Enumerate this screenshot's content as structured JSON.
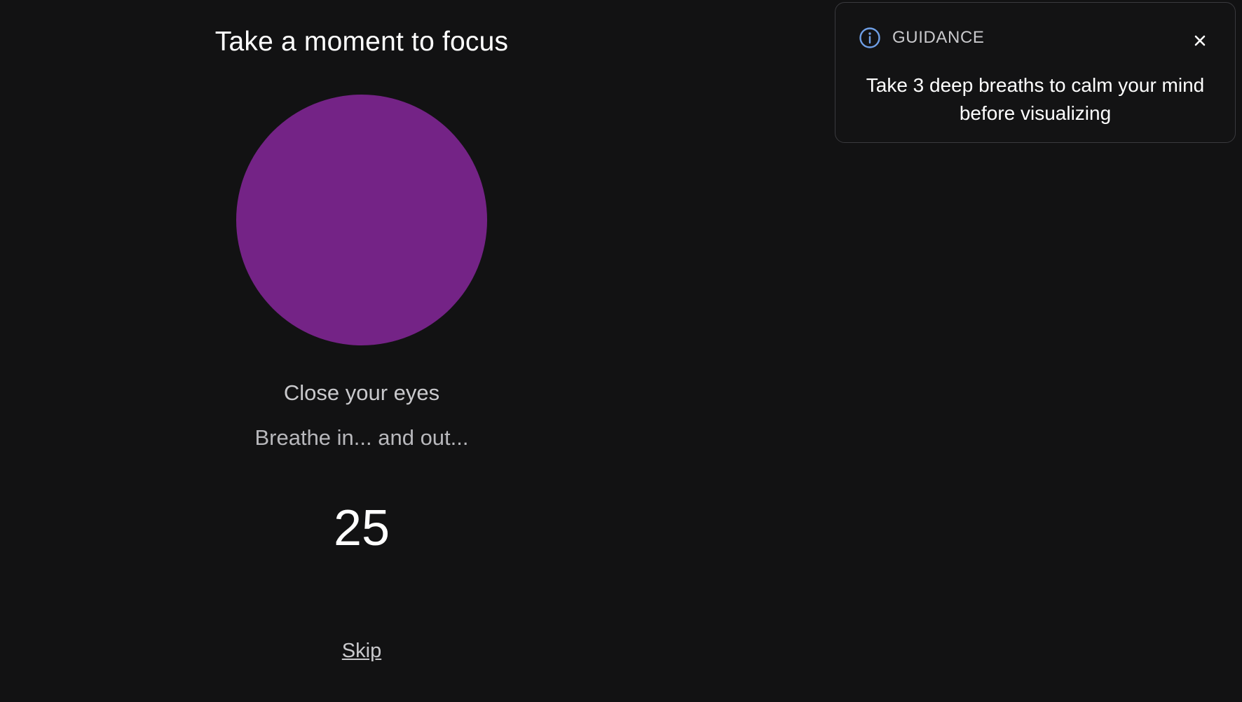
{
  "focus": {
    "title": "Take a moment to focus",
    "instruction": "Close your eyes",
    "sub_instruction": "Breathe in... and out...",
    "countdown": "25",
    "skip_label": "Skip",
    "circle_color": "#742386"
  },
  "guidance": {
    "label": "GUIDANCE",
    "message": "Take 3 deep breaths to calm your mind before visualizing",
    "icon": "info-icon",
    "close_icon": "close-icon",
    "icon_color": "#6f9fe6"
  }
}
